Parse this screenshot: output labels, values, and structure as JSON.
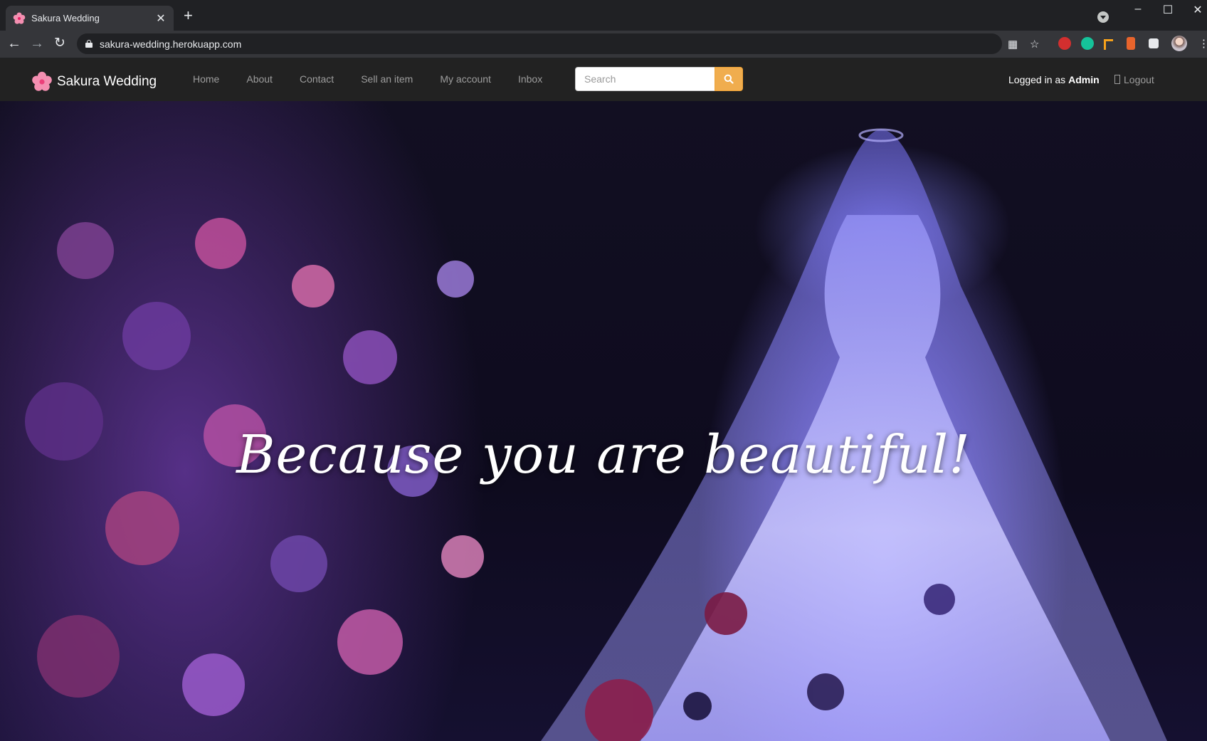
{
  "browser": {
    "tab_title": "Sakura Wedding",
    "tab_close": "✕",
    "new_tab": "+",
    "url": "sakura-wedding.herokuapp.com",
    "window_controls": [
      "–",
      "☐",
      "✕"
    ],
    "nav_icons": [
      "back-icon",
      "forward-icon",
      "reload-icon"
    ],
    "extensions": [
      "translate-icon",
      "bookmark-star-icon",
      "adblock-icon",
      "grammarly-icon",
      "extension-icon",
      "extensions-puzzle-icon",
      "profile-avatar"
    ]
  },
  "site": {
    "brand": "Sakura Wedding",
    "nav": [
      "Home",
      "About",
      "Contact",
      "Sell an item",
      "My account",
      "Inbox"
    ],
    "search_placeholder": "Search",
    "logged_in_prefix": "Logged in as ",
    "username": "Admin",
    "logout": "Logout",
    "accent_color": "#f0ad4e",
    "navbar_color": "#222222"
  },
  "hero": {
    "tagline": "Because you are beautiful!"
  }
}
